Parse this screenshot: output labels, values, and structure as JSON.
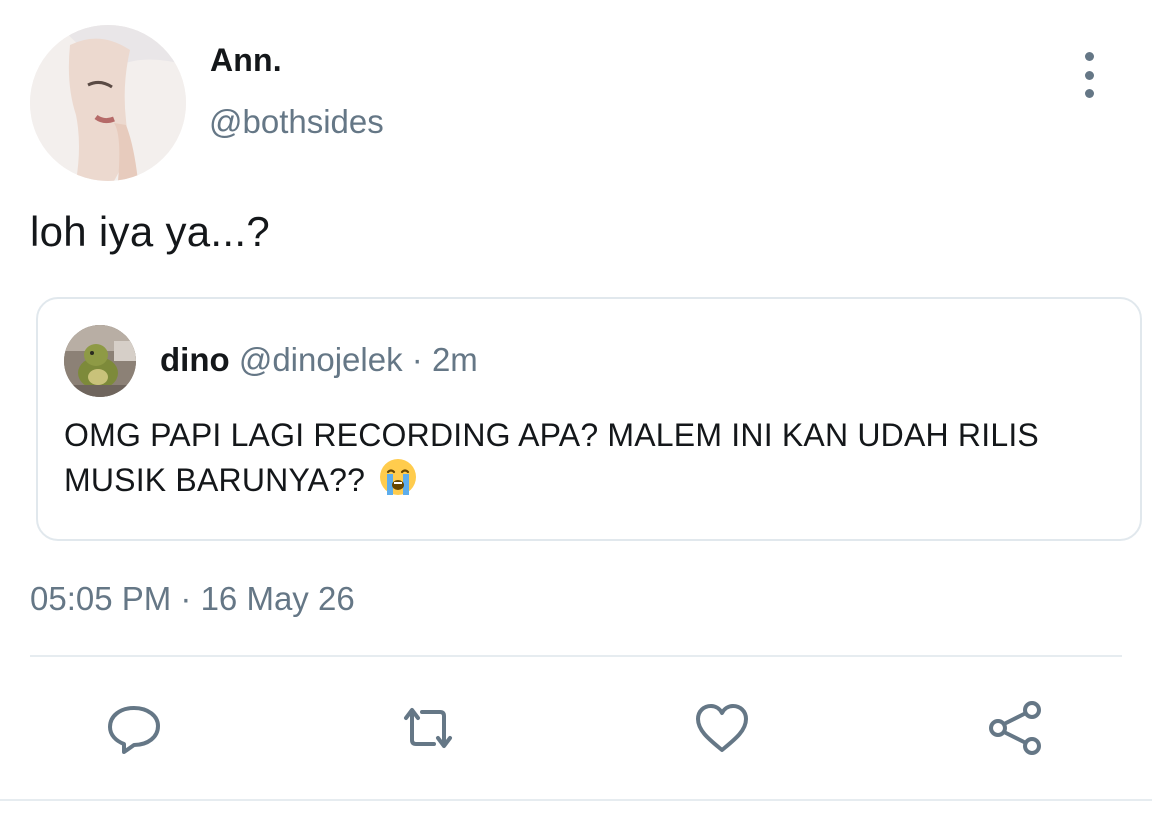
{
  "tweet": {
    "author": {
      "display_name": "Ann.",
      "handle": "@bothsides"
    },
    "text": "loh iya ya...?",
    "quoted": {
      "display_name": "dino",
      "handle": "@dinojelek",
      "separator": "·",
      "time_ago": "2m",
      "text": "OMG PAPI LAGI RECORDING APA? MALEM INI KAN UDAH RILIS MUSIK BARUNYA??",
      "emoji_name": "loudly-crying-face-emoji"
    },
    "timestamp": "05:05 PM · 16 May 26"
  },
  "actions": [
    {
      "name": "reply",
      "icon": "reply-bubble-icon"
    },
    {
      "name": "retweet",
      "icon": "retweet-icon"
    },
    {
      "name": "like",
      "icon": "heart-icon"
    },
    {
      "name": "share",
      "icon": "share-icon"
    }
  ],
  "colors": {
    "text_primary": "#14171a",
    "text_secondary": "#657786",
    "border": "#e1e8ed",
    "icon": "#657786"
  }
}
